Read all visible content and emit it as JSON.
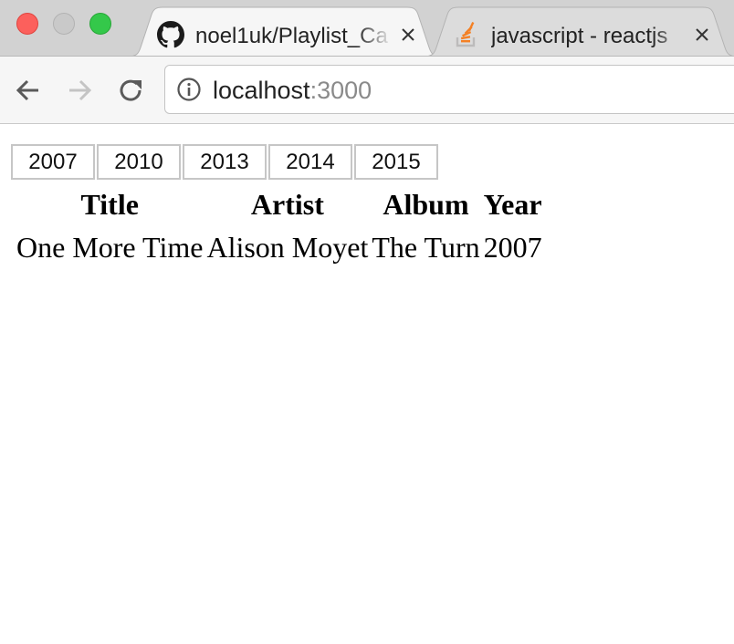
{
  "browser": {
    "tabs": [
      {
        "title": "noel1uk/Playlist_Ca",
        "icon": "github-icon",
        "active": true
      },
      {
        "title": "javascript - reactjs",
        "icon": "stackoverflow-icon",
        "active": false
      }
    ],
    "address": {
      "host": "localhost",
      "port": ":3000"
    }
  },
  "page": {
    "year_buttons": [
      "2007",
      "2010",
      "2013",
      "2014",
      "2015"
    ],
    "table": {
      "headers": [
        "Title",
        "Artist",
        "Album",
        "Year"
      ],
      "rows": [
        [
          "One More Time",
          "Alison Moyet",
          "The Turn",
          "2007"
        ]
      ]
    }
  },
  "colors": {
    "close": "#fc605c",
    "minimize": "#c9c9c9",
    "maximize": "#34c84a",
    "tab_strip": "#d2d2d2",
    "toolbar": "#f6f6f6"
  }
}
